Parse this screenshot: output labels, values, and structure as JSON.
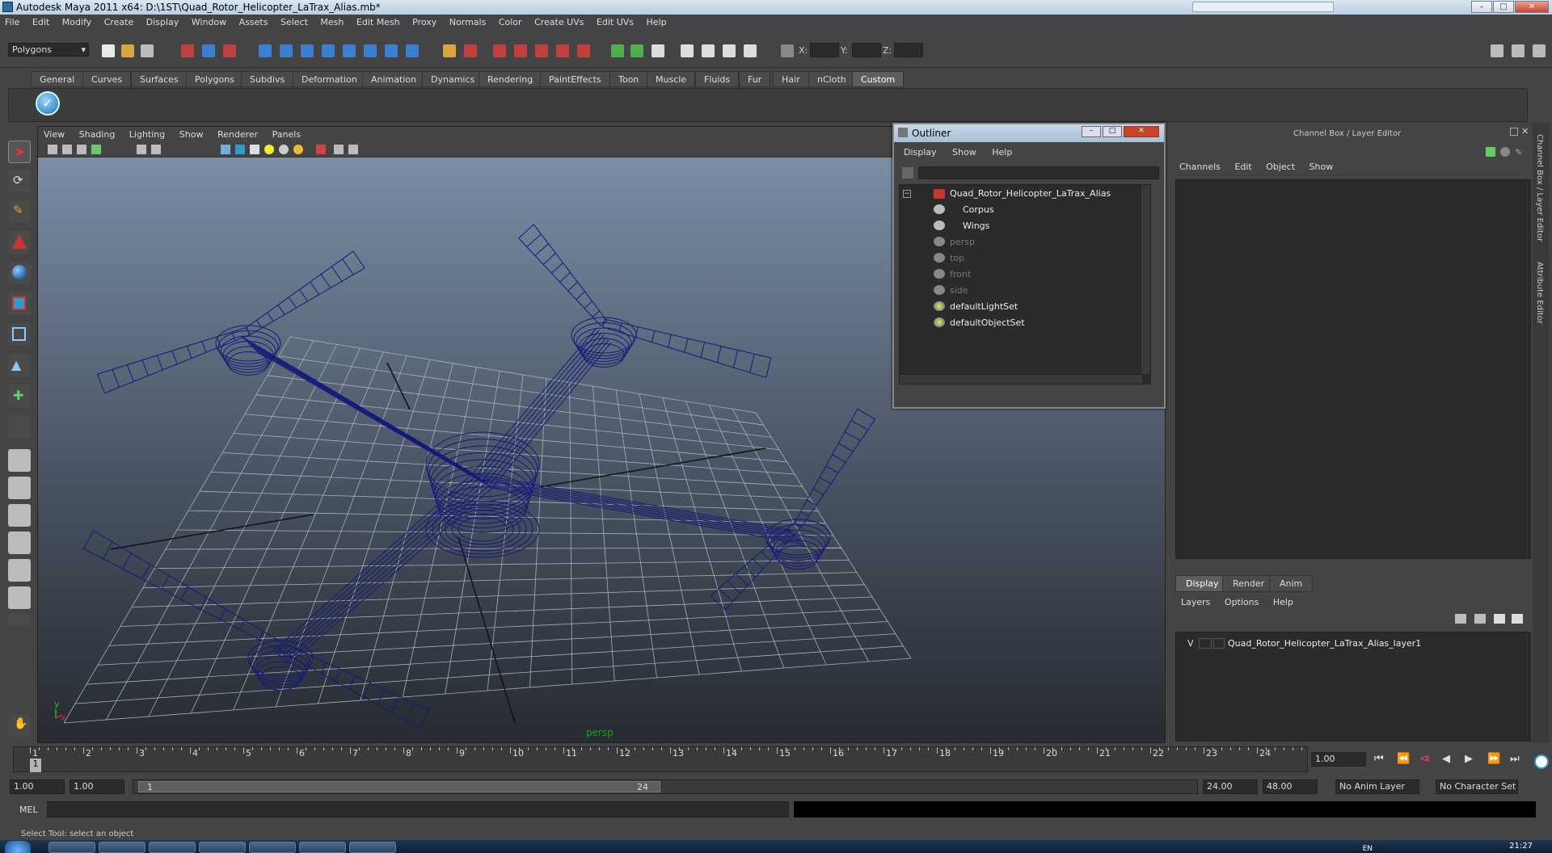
{
  "window": {
    "title": "Autodesk Maya 2011 x64: D:\\1ST\\Quad_Rotor_Helicopter_LaTrax_Alias.mb*",
    "minimize": "–",
    "maximize": "□",
    "close": "✕"
  },
  "menubar": [
    "File",
    "Edit",
    "Modify",
    "Create",
    "Display",
    "Window",
    "Assets",
    "Select",
    "Mesh",
    "Edit Mesh",
    "Proxy",
    "Normals",
    "Color",
    "Create UVs",
    "Edit UVs",
    "Help"
  ],
  "statusline": {
    "menuset": "Polygons",
    "x_label": "X:",
    "y_label": "Y:",
    "z_label": "Z:"
  },
  "shelf": {
    "tabs": [
      "General",
      "Curves",
      "Surfaces",
      "Polygons",
      "Subdivs",
      "Deformation",
      "Animation",
      "Dynamics",
      "Rendering",
      "PaintEffects",
      "Toon",
      "Muscle",
      "Fluids",
      "Fur",
      "Hair",
      "nCloth",
      "Custom"
    ],
    "active_tab": "Custom"
  },
  "viewport": {
    "menu": [
      "View",
      "Shading",
      "Lighting",
      "Show",
      "Renderer",
      "Panels"
    ],
    "camera": "persp",
    "axis_y": "y",
    "axis_x": "x"
  },
  "outliner": {
    "title": "Outliner",
    "menu": [
      "Display",
      "Show",
      "Help"
    ],
    "items": [
      {
        "label": "Quad_Rotor_Helicopter_LaTrax_Alias",
        "dim": false
      },
      {
        "label": "Corpus",
        "dim": false
      },
      {
        "label": "Wings",
        "dim": false
      },
      {
        "label": "persp",
        "dim": true
      },
      {
        "label": "top",
        "dim": true
      },
      {
        "label": "front",
        "dim": true
      },
      {
        "label": "side",
        "dim": true
      },
      {
        "label": "defaultLightSet",
        "dim": false
      },
      {
        "label": "defaultObjectSet",
        "dim": false
      }
    ]
  },
  "channelbox": {
    "title": "Channel Box / Layer Editor",
    "menu": [
      "Channels",
      "Edit",
      "Object",
      "Show"
    ],
    "layer_tabs": [
      "Display",
      "Render",
      "Anim"
    ],
    "layer_menu": [
      "Layers",
      "Options",
      "Help"
    ],
    "layer": {
      "visible": "V",
      "name": "Quad_Rotor_Helicopter_LaTrax_Alias_layer1"
    }
  },
  "sidetabs": [
    "Channel Box / Layer Editor",
    "Attribute Editor"
  ],
  "timeslider": {
    "ticks": [
      "1",
      "2",
      "3",
      "4",
      "5",
      "6",
      "7",
      "8",
      "9",
      "10",
      "11",
      "12",
      "13",
      "14",
      "15",
      "16",
      "17",
      "18",
      "19",
      "20",
      "21",
      "22",
      "23",
      "24"
    ],
    "current_frame": "1",
    "current_time": "1.00",
    "buttons": [
      "⏮",
      "⏪",
      "⧏",
      "◀",
      "▶",
      "⏩",
      "⏭"
    ]
  },
  "rangeslider": {
    "start_time": "1.00",
    "playback_start": "1.00",
    "range_start": "1",
    "range_end": "24",
    "playback_end": "24.00",
    "end_time": "48.00",
    "anim_layer": "No Anim Layer",
    "character_set": "No Character Set"
  },
  "commandline": {
    "label": "MEL",
    "help": "Select Tool: select an object"
  },
  "taskbar": {
    "lang": "EN",
    "clock": "21:27"
  },
  "colors": {
    "wire": "#141a7a",
    "grid": "#a8b0bc",
    "accent": "#5d5d5d"
  }
}
